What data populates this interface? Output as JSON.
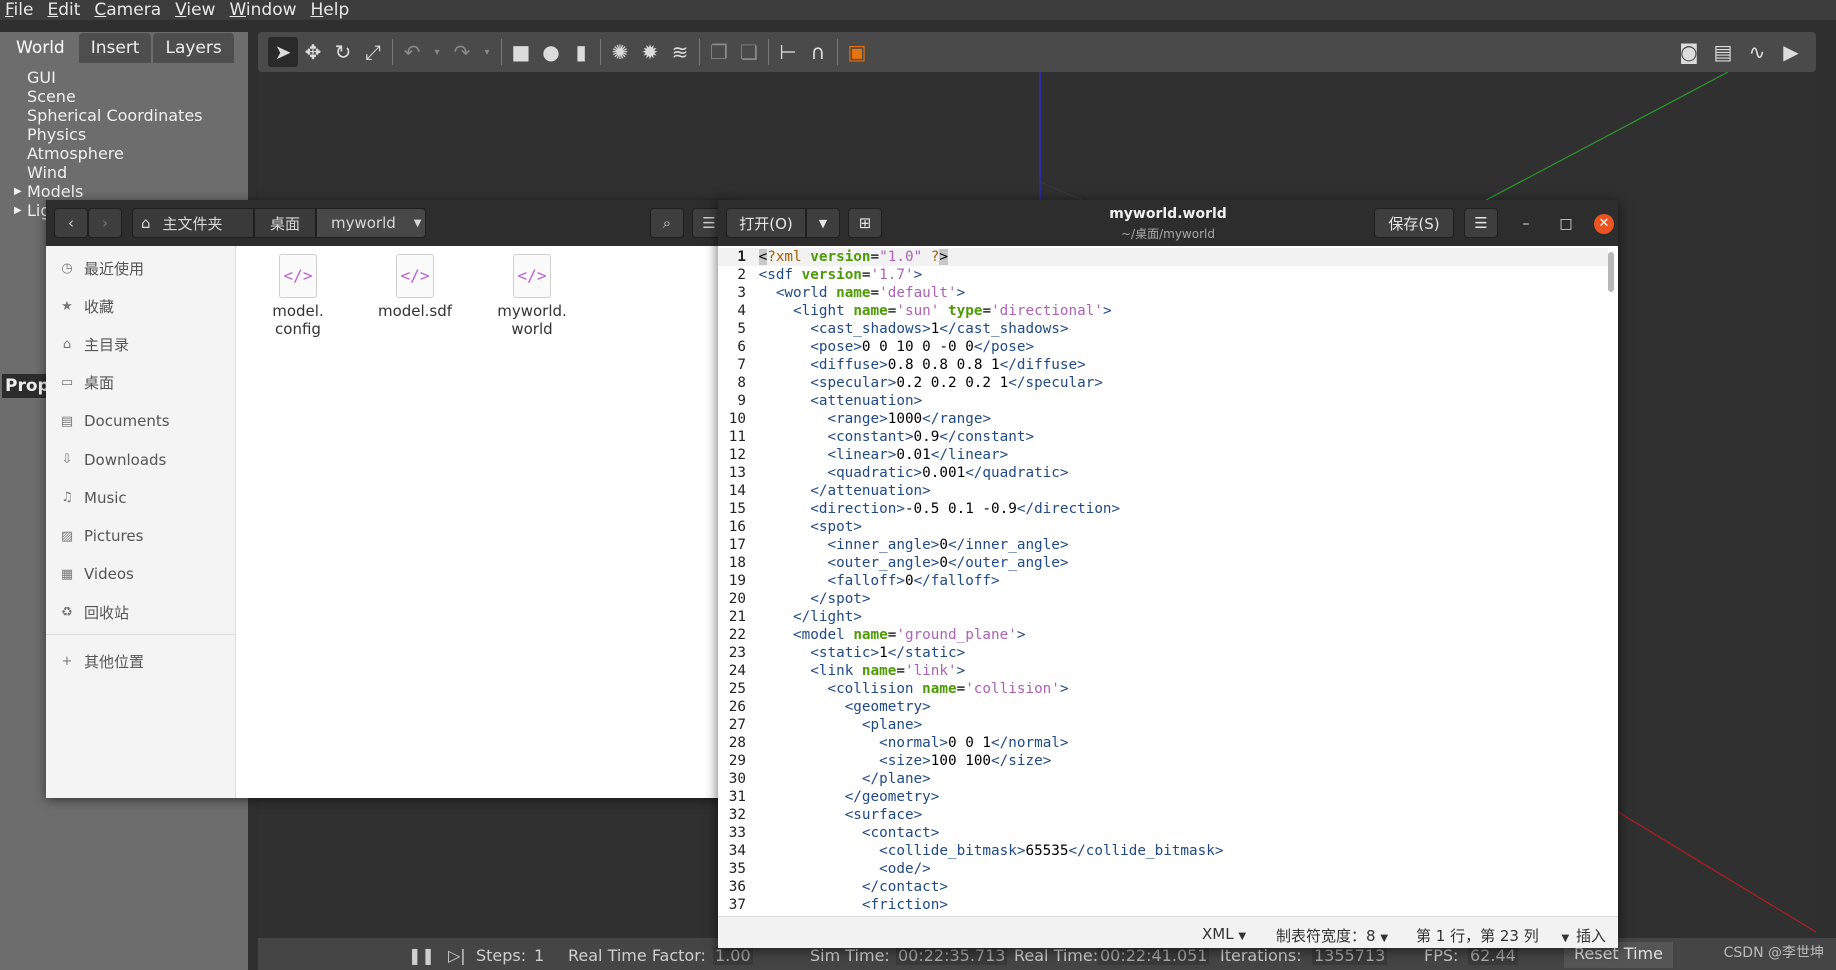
{
  "menubar": [
    "File",
    "Edit",
    "Camera",
    "View",
    "Window",
    "Help"
  ],
  "left_panel": {
    "tabs": [
      "World",
      "Insert",
      "Layers"
    ],
    "tree": [
      {
        "label": "GUI",
        "arrow": false
      },
      {
        "label": "Scene",
        "arrow": false
      },
      {
        "label": "Spherical Coordinates",
        "arrow": false
      },
      {
        "label": "Physics",
        "arrow": false
      },
      {
        "label": "Atmosphere",
        "arrow": false
      },
      {
        "label": "Wind",
        "arrow": false
      },
      {
        "label": "Models",
        "arrow": true
      },
      {
        "label": "Lig",
        "arrow": true
      }
    ],
    "properties_tab": "Prop"
  },
  "statusbar": {
    "steps_label": "Steps:",
    "steps_value": "1",
    "rtf_label": "Real Time Factor:",
    "rtf_value": "1.00",
    "sim_label": "Sim Time:",
    "sim_value": "00:22:35.713",
    "real_label": "Real Time:",
    "real_value": "00:22:41.051",
    "iter_label": "Iterations:",
    "iter_value": "1355713",
    "fps_label": "FPS:",
    "fps_value": "62.44",
    "reset_label": "Reset Time"
  },
  "watermark": "CSDN @李世坤",
  "file_manager": {
    "breadcrumb": [
      "主文件夹",
      "桌面",
      "myworld"
    ],
    "sidebar": [
      {
        "label": "最近使用",
        "icon": "clock-icon"
      },
      {
        "label": "收藏",
        "icon": "star-icon"
      },
      {
        "label": "主目录",
        "icon": "home-icon"
      },
      {
        "label": "桌面",
        "icon": "desktop-icon"
      },
      {
        "label": "Documents",
        "icon": "document-icon"
      },
      {
        "label": "Downloads",
        "icon": "download-icon"
      },
      {
        "label": "Music",
        "icon": "music-icon"
      },
      {
        "label": "Pictures",
        "icon": "picture-icon"
      },
      {
        "label": "Videos",
        "icon": "video-icon"
      },
      {
        "label": "回收站",
        "icon": "trash-icon"
      },
      {
        "label": "其他位置",
        "icon": "plus-icon"
      }
    ],
    "files": [
      {
        "line1": "model.",
        "line2": "config"
      },
      {
        "line1": "model.sdf",
        "line2": ""
      },
      {
        "line1": "myworld.",
        "line2": "world"
      }
    ]
  },
  "editor": {
    "open_label": "打开(O)",
    "save_label": "保存(S)",
    "title": "myworld.world",
    "subtitle": "~/桌面/myworld",
    "status": {
      "language": "XML",
      "tab_width": "制表符宽度：8",
      "position": "第 1 行，第 23 列",
      "mode": "插入"
    },
    "lines": [
      "<?xml version=\"1.0\" ?>",
      "<sdf version='1.7'>",
      "  <world name='default'>",
      "    <light name='sun' type='directional'>",
      "      <cast_shadows>1</cast_shadows>",
      "      <pose>0 0 10 0 -0 0</pose>",
      "      <diffuse>0.8 0.8 0.8 1</diffuse>",
      "      <specular>0.2 0.2 0.2 1</specular>",
      "      <attenuation>",
      "        <range>1000</range>",
      "        <constant>0.9</constant>",
      "        <linear>0.01</linear>",
      "        <quadratic>0.001</quadratic>",
      "      </attenuation>",
      "      <direction>-0.5 0.1 -0.9</direction>",
      "      <spot>",
      "        <inner_angle>0</inner_angle>",
      "        <outer_angle>0</outer_angle>",
      "        <falloff>0</falloff>",
      "      </spot>",
      "    </light>",
      "    <model name='ground_plane'>",
      "      <static>1</static>",
      "      <link name='link'>",
      "        <collision name='collision'>",
      "          <geometry>",
      "            <plane>",
      "              <normal>0 0 1</normal>",
      "              <size>100 100</size>",
      "            </plane>",
      "          </geometry>",
      "          <surface>",
      "            <contact>",
      "              <collide_bitmask>65535</collide_bitmask>",
      "              <ode/>",
      "            </contact>",
      "            <friction>"
    ]
  },
  "colors": {
    "gazebo_bg": "#2f2f2f",
    "panel": "#6d6d6d",
    "header_dark": "#2d2d2d",
    "close_orange": "#e95420",
    "xml_tag": "#204a87",
    "xml_attr": "#4e9a06",
    "xml_value": "#ad62b6"
  }
}
